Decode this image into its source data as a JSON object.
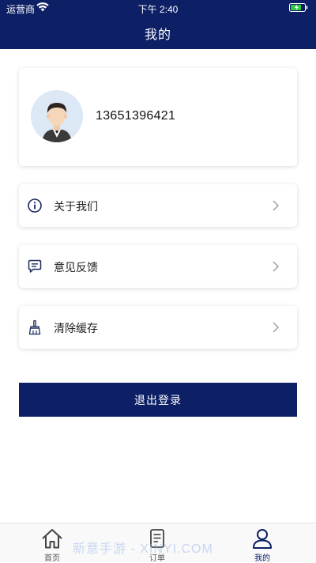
{
  "status_bar": {
    "carrier": "运营商",
    "time": "下午 2:40",
    "wifi_icon": "wifi-icon",
    "battery_icon": "battery-charging-icon"
  },
  "header": {
    "title": "我的"
  },
  "profile": {
    "avatar_icon": "user-avatar",
    "phone": "13651396421"
  },
  "menu": {
    "items": [
      {
        "icon": "info-circle-icon",
        "label": "关于我们"
      },
      {
        "icon": "chat-bubble-icon",
        "label": "意见反馈"
      },
      {
        "icon": "broom-icon",
        "label": "清除缓存"
      }
    ]
  },
  "logout": {
    "label": "退出登录"
  },
  "tab_bar": {
    "active_color": "#0d2066",
    "items": [
      {
        "icon": "home-icon",
        "label": "首页"
      },
      {
        "icon": "document-icon",
        "label": "订单"
      },
      {
        "icon": "person-icon",
        "label": "我的"
      }
    ]
  },
  "watermark": "新意手游 - XINYI.COM",
  "colors": {
    "primary": "#0d2066",
    "background": "#ffffff",
    "battery": "#2ecc40"
  }
}
